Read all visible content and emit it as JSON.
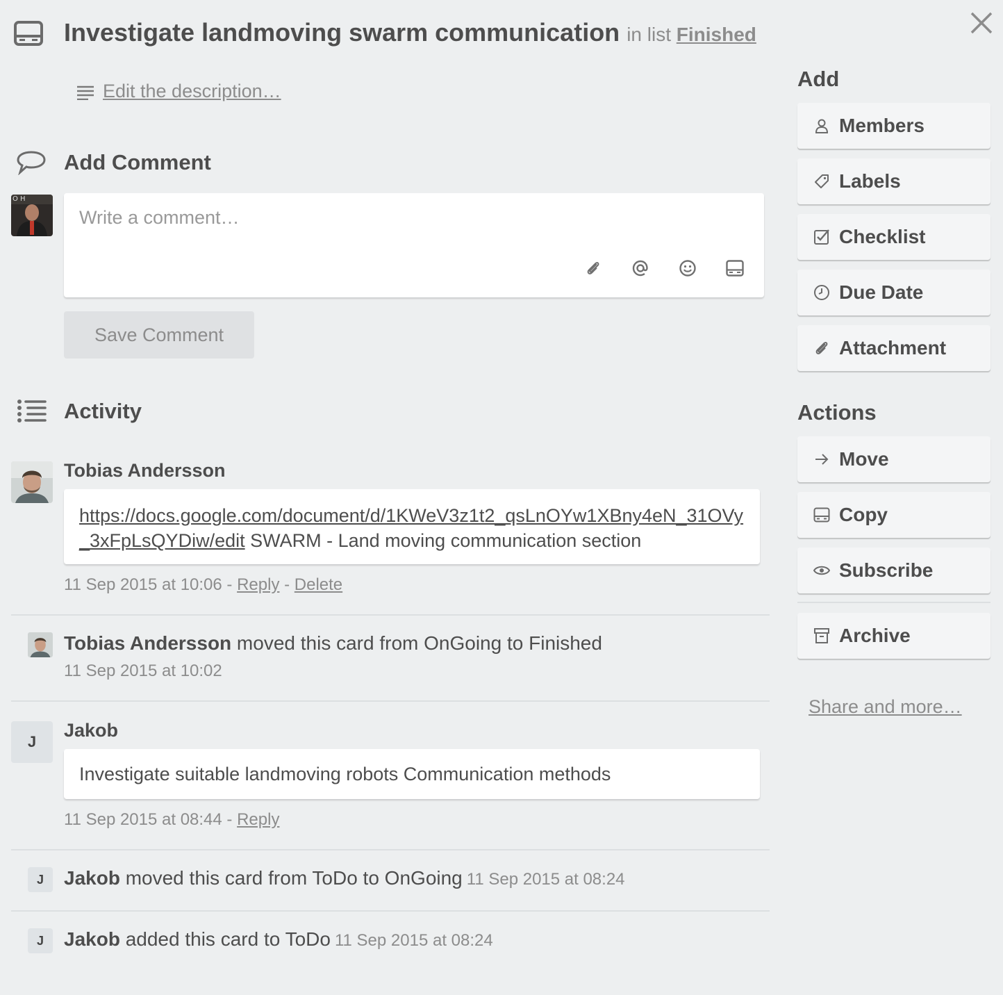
{
  "card": {
    "title": "Investigate landmoving swarm communication",
    "in_list_prefix": "in list",
    "list_name": "Finished",
    "edit_description": "Edit the description…"
  },
  "add_comment": {
    "heading": "Add Comment",
    "placeholder": "Write a comment…",
    "save_label": "Save Comment"
  },
  "activity": {
    "heading": "Activity",
    "comment1": {
      "author": "Tobias Andersson",
      "link": "https://docs.google.com/document/d/1KWeV3z1t2_qsLnOYw1XBny4eN_31OVy_3xFpLsQYDiw/edit",
      "text": " SWARM - Land moving communication section",
      "time": "11 Sep 2015 at 10:06",
      "sep1": " - ",
      "reply": "Reply",
      "sep2": " - ",
      "delete": "Delete"
    },
    "move1": {
      "author": "Tobias Andersson",
      "text": " moved this card from OnGoing to Finished",
      "time": "11 Sep 2015 at 10:02"
    },
    "comment2": {
      "initial": "J",
      "author": "Jakob",
      "text": "Investigate suitable landmoving robots Communication methods",
      "time": "11 Sep 2015 at 08:44",
      "sep1": " - ",
      "reply": "Reply"
    },
    "move2": {
      "initial": "J",
      "author": "Jakob",
      "text": " moved this card from ToDo to OnGoing",
      "time": "11 Sep 2015 at 08:24"
    },
    "add1": {
      "initial": "J",
      "author": "Jakob",
      "text": " added this card to ToDo",
      "time": "11 Sep 2015 at 08:24"
    }
  },
  "sidebar": {
    "add_heading": "Add",
    "add_buttons": [
      {
        "label": "Members",
        "icon": "person-icon"
      },
      {
        "label": "Labels",
        "icon": "tag-icon"
      },
      {
        "label": "Checklist",
        "icon": "checkbox-icon"
      },
      {
        "label": "Due Date",
        "icon": "clock-icon"
      },
      {
        "label": "Attachment",
        "icon": "paperclip-icon"
      }
    ],
    "actions_heading": "Actions",
    "action_buttons": [
      {
        "label": "Move",
        "icon": "arrow-right-icon"
      },
      {
        "label": "Copy",
        "icon": "card-icon"
      },
      {
        "label": "Subscribe",
        "icon": "eye-icon"
      },
      {
        "label": "Archive",
        "icon": "archive-icon"
      }
    ],
    "share_more": "Share and more…"
  }
}
